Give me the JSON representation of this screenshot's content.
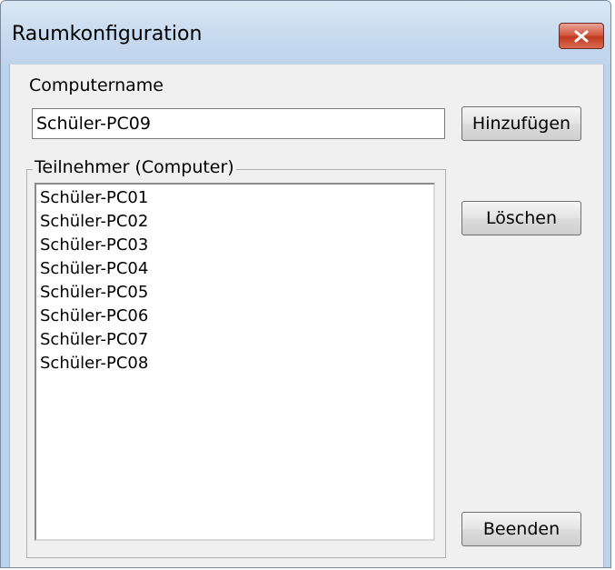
{
  "window": {
    "title": "Raumkonfiguration"
  },
  "icons": {
    "close": "close-x-icon"
  },
  "colors": {
    "close_button": "#c9472f",
    "titlebar": "#c5d9ef",
    "client_bg": "#f0f0f0"
  },
  "form": {
    "computername_label": "Computername",
    "computername_value": "Schüler-PC09",
    "add_button": "Hinzufügen",
    "delete_button": "Löschen",
    "exit_button": "Beenden",
    "group_label": "Teilnehmer (Computer)",
    "participants": [
      "Schüler-PC01",
      "Schüler-PC02",
      "Schüler-PC03",
      "Schüler-PC04",
      "Schüler-PC05",
      "Schüler-PC06",
      "Schüler-PC07",
      "Schüler-PC08"
    ]
  }
}
